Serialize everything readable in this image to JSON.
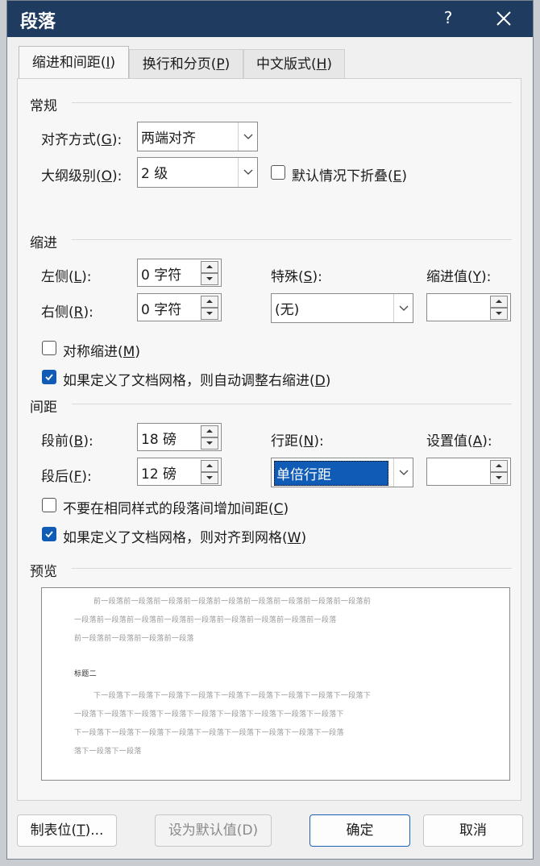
{
  "title": "段落",
  "help": "?",
  "tabs": [
    {
      "label": "缩进和间距(",
      "key": "I",
      "end": ")"
    },
    {
      "label": "换行和分页(",
      "key": "P",
      "end": ")"
    },
    {
      "label": "中文版式(",
      "key": "H",
      "end": ")"
    }
  ],
  "general": {
    "heading": "常规",
    "alignment_label": "对齐方式(",
    "alignment_key": "G",
    "alignment_end": "):",
    "alignment_value": "两端对齐",
    "outline_label": "大纲级别(",
    "outline_key": "O",
    "outline_end": "):",
    "outline_value": "2 级",
    "collapse_label": "默认情况下折叠(",
    "collapse_key": "E",
    "collapse_end": ")",
    "collapse_checked": false
  },
  "indent": {
    "heading": "缩进",
    "left_label": "左侧(",
    "left_key": "L",
    "left_end": "):",
    "left_value": "0 字符",
    "right_label": "右侧(",
    "right_key": "R",
    "right_end": "):",
    "right_value": "0 字符",
    "special_label": "特殊(",
    "special_key": "S",
    "special_end": "):",
    "special_value": "(无)",
    "by_label": "缩进值(",
    "by_key": "Y",
    "by_end": "):",
    "by_value": "",
    "mirror_label": "对称缩进(",
    "mirror_key": "M",
    "mirror_end": ")",
    "mirror_checked": false,
    "auto_label": "如果定义了文档网格，则自动调整右缩进(",
    "auto_key": "D",
    "auto_end": ")",
    "auto_checked": true
  },
  "spacing": {
    "heading": "间距",
    "before_label": "段前(",
    "before_key": "B",
    "before_end": "):",
    "before_value": "18 磅",
    "after_label": "段后(",
    "after_key": "F",
    "after_end": "):",
    "after_value": "12 磅",
    "line_label": "行距(",
    "line_key": "N",
    "line_end": "):",
    "line_value": "单倍行距",
    "at_label": "设置值(",
    "at_key": "A",
    "at_end": "):",
    "at_value": "",
    "nospace_label": "不要在相同样式的段落间增加间距(",
    "nospace_key": "C",
    "nospace_end": ")",
    "nospace_checked": false,
    "snap_label": "如果定义了文档网格，则对齐到网格(",
    "snap_key": "W",
    "snap_end": ")",
    "snap_checked": true
  },
  "preview": {
    "heading": "预览",
    "prev_lines": [
      "前一段落前一段落前一段落前一段落前一段落前一段落前一段落前一段落前一段落前",
      "一段落前一段落前一段落前一段落前一段落前一段落前一段落前一段落前一段落",
      "前一段落前一段落前一段落前一段落"
    ],
    "sample": "标题二",
    "next_lines": [
      "下一段落下一段落下一段落下一段落下一段落下一段落下一段落下一段落下一段落下",
      "一段落下一段落下一段落下一段落下一段落下一段落下一段落下一段落下一段落下",
      "下一段落下一段落下一段落下一段落下一段落下一段落下一段落下一段落下一段落",
      "落下一段落下一段落"
    ]
  },
  "buttons": {
    "tabs_label": "制表位(",
    "tabs_key": "T",
    "tabs_end": ")...",
    "default_label": "设为默认值(D)",
    "ok": "确定",
    "cancel": "取消"
  },
  "colors": {
    "titlebar": "#1f3b5f",
    "accent": "#0f5bb5",
    "selection": "#0f5bb5"
  }
}
